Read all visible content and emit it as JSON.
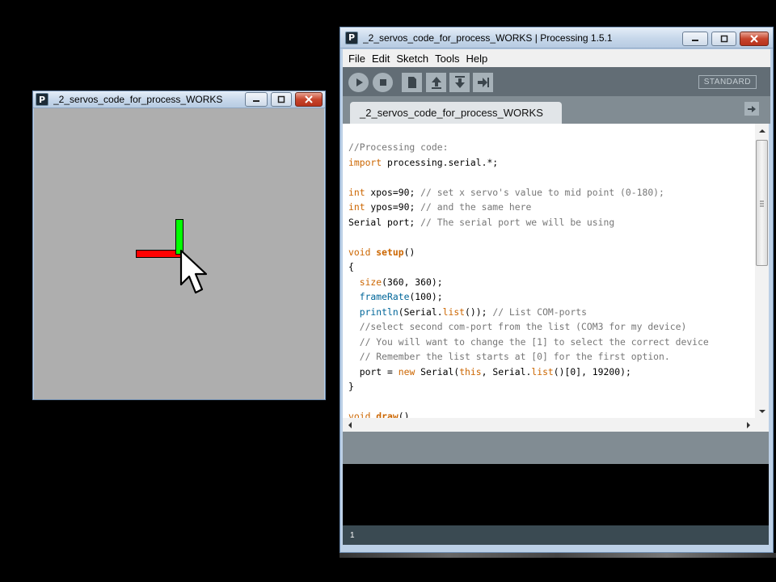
{
  "sketch_window": {
    "title": "_2_servos_code_for_process_WORKS",
    "icon_letter": "P"
  },
  "ide_window": {
    "title": "_2_servos_code_for_process_WORKS | Processing 1.5.1",
    "icon_letter": "P",
    "menu": [
      "File",
      "Edit",
      "Sketch",
      "Tools",
      "Help"
    ],
    "mode": "STANDARD",
    "tab": "_2_servos_code_for_process_WORKS",
    "status_line": "1"
  },
  "code_lines": [
    "//Processing code:",
    "import processing.serial.*;",
    "",
    "int xpos=90; // set x servo's value to mid point (0-180);",
    "int ypos=90; // and the same here",
    "Serial port; // The serial port we will be using",
    "",
    "void setup()",
    "{",
    "  size(360, 360);",
    "  frameRate(100);",
    "  println(Serial.list()); // List COM-ports",
    "  //select second com-port from the list (COM3 for my device)",
    "  // You will want to change the [1] to select the correct device",
    "  // Remember the list starts at [0] for the first option.",
    "  port = new Serial(this, Serial.list()[0], 19200);",
    "}",
    "",
    "void draw()"
  ],
  "colors": {
    "keyword": "#cc6600",
    "builtin": "#006699",
    "comment": "#777777",
    "x_bar": "#ff0000",
    "y_bar": "#00ff00"
  }
}
